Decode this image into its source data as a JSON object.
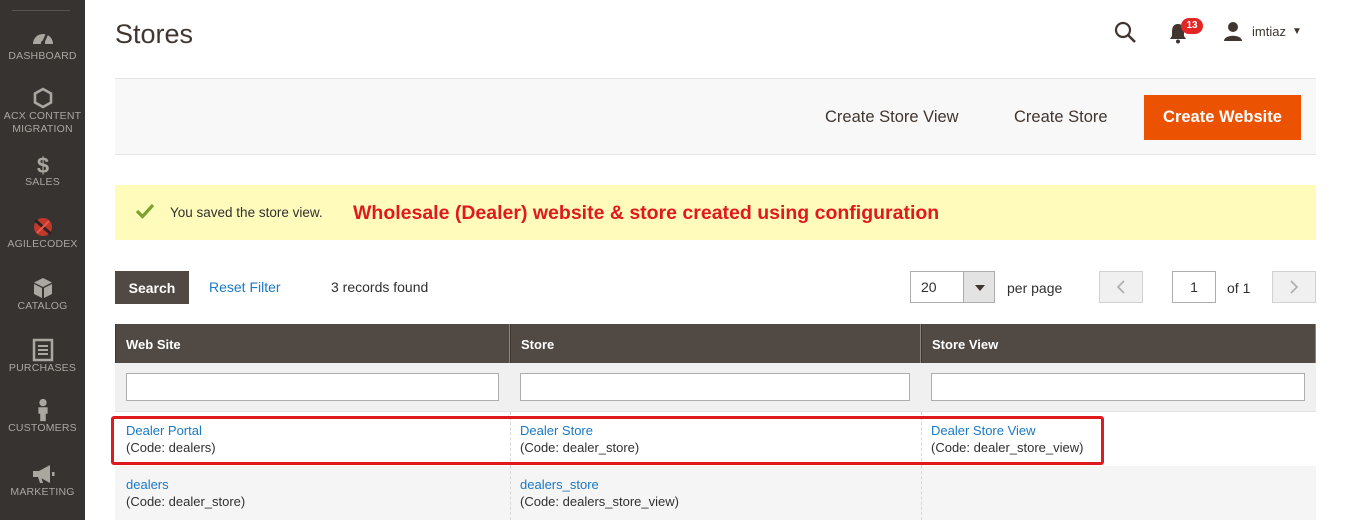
{
  "sidebar": {
    "items": [
      {
        "label": "DASHBOARD",
        "icon": "dashboard-icon"
      },
      {
        "label": "ACX CONTENT\nMIGRATION",
        "icon": "hexagon-icon"
      },
      {
        "label": "SALES",
        "icon": "dollar-icon"
      },
      {
        "label": "AGILECODEX",
        "icon": "agilecodex-logo-icon"
      },
      {
        "label": "CATALOG",
        "icon": "box-icon"
      },
      {
        "label": "PURCHASES",
        "icon": "document-icon"
      },
      {
        "label": "CUSTOMERS",
        "icon": "person-icon"
      },
      {
        "label": "MARKETING",
        "icon": "megaphone-icon"
      }
    ]
  },
  "header": {
    "title": "Stores",
    "notifications_count": "13",
    "username": "imtiaz"
  },
  "actions": {
    "create_store_view": "Create Store View",
    "create_store": "Create Store",
    "create_website": "Create Website"
  },
  "message": {
    "text": "You saved the store view.",
    "annotation": "Wholesale (Dealer) website & store created using configuration"
  },
  "grid_controls": {
    "search_label": "Search",
    "reset_filter_label": "Reset Filter",
    "records_found": "3 records found",
    "per_page_value": "20",
    "per_page_label": "per page",
    "current_page": "1",
    "total_pages_label": "of 1"
  },
  "table": {
    "columns": [
      "Web Site",
      "Store",
      "Store View"
    ],
    "rows": [
      {
        "website": "Dealer Portal",
        "website_code": "(Code: dealers)",
        "store": "Dealer Store",
        "store_code": "(Code: dealer_store)",
        "view": "Dealer Store View",
        "view_code": "(Code: dealer_store_view)"
      },
      {
        "website": "dealers",
        "website_code": "(Code: dealer_store)",
        "store": "dealers_store",
        "store_code": "(Code: dealers_store_view)",
        "view": "",
        "view_code": ""
      }
    ]
  },
  "colors": {
    "sidebar_bg": "#373330",
    "primary_button": "#eb5202",
    "link": "#1979c3",
    "annotation_red": "#e0191e",
    "message_bg": "#fffbbb",
    "grid_header": "#514943"
  }
}
